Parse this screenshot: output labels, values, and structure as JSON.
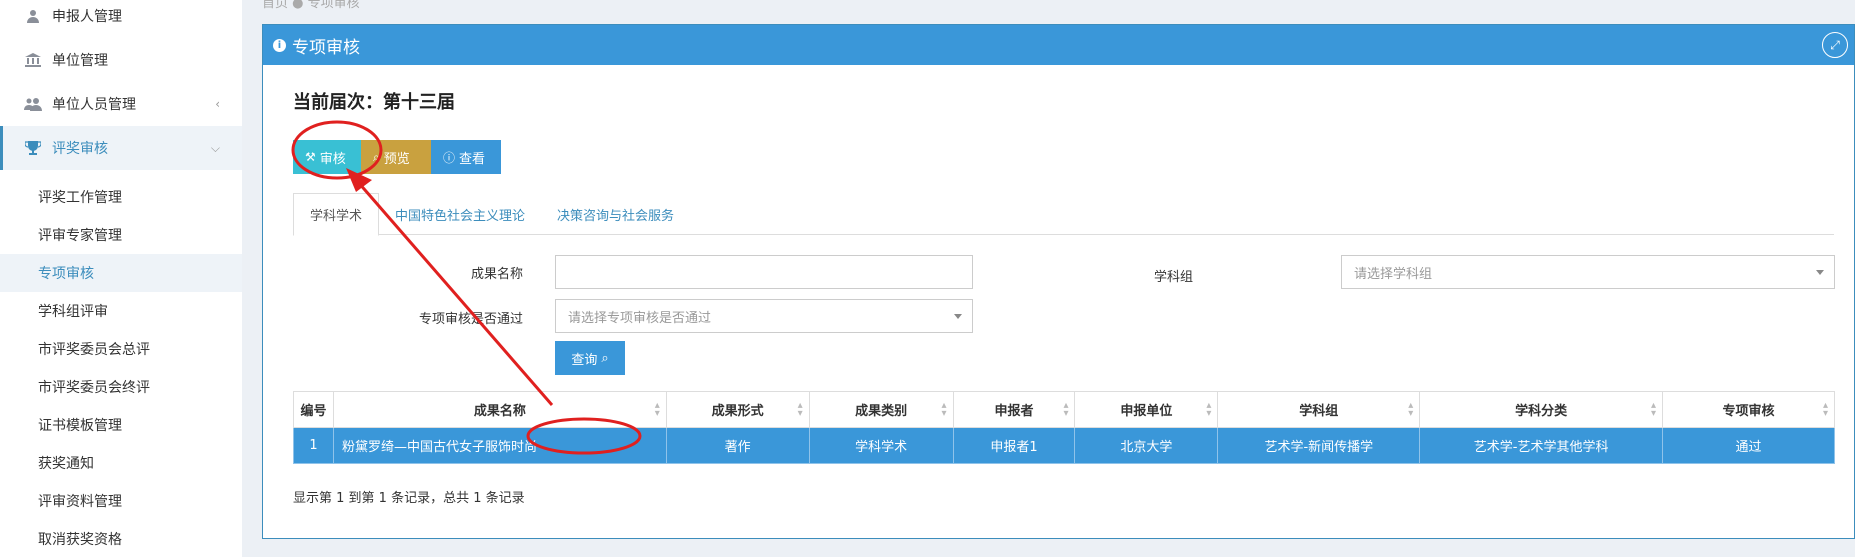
{
  "sidebar": {
    "items": [
      {
        "label": "申报人管理",
        "icon": "user-icon"
      },
      {
        "label": "单位管理",
        "icon": "bank-icon"
      },
      {
        "label": "单位人员管理",
        "icon": "users-icon"
      },
      {
        "label": "评奖审核",
        "icon": "trophy-icon"
      }
    ],
    "sub_items": [
      "评奖工作管理",
      "评审专家管理",
      "专项审核",
      "学科组评审",
      "市评奖委员会总评",
      "市评奖委员会终评",
      "证书模板管理",
      "获奖通知",
      "评审资料管理",
      "取消获奖资格"
    ]
  },
  "breadcrumb": {
    "home": "首页",
    "current": "专项审核"
  },
  "panel": {
    "title": "专项审核"
  },
  "session": {
    "text": "当前届次：第十三届"
  },
  "toolbar": {
    "audit": "审核",
    "preview": "预览",
    "view": "查看"
  },
  "tabs": [
    "学科学术",
    "中国特色社会主义理论",
    "决策咨询与社会服务"
  ],
  "form": {
    "name_label": "成果名称",
    "name_value": "",
    "group_label": "学科组",
    "group_placeholder": "请选择学科组",
    "pass_label": "专项审核是否通过",
    "pass_placeholder": "请选择专项审核是否通过",
    "search_button": "查询"
  },
  "table": {
    "headers": [
      "编号",
      "成果名称",
      "成果形式",
      "成果类别",
      "申报者",
      "申报单位",
      "学科组",
      "学科分类",
      "专项审核"
    ],
    "rows": [
      [
        "1",
        "粉黛罗绮—中国古代女子服饰时尚",
        "著作",
        "学科学术",
        "申报者1",
        "北京大学",
        "艺术学-新闻传播学",
        "艺术学-艺术学其他学科",
        "通过"
      ]
    ]
  },
  "pagination": {
    "summary": "显示第 1 到第 1 条记录，总共 1 条记录"
  },
  "colors": {
    "primary": "#3a97d9",
    "audit": "#39c0d4",
    "preview": "#c9a13f",
    "annotation": "#e0201f"
  }
}
